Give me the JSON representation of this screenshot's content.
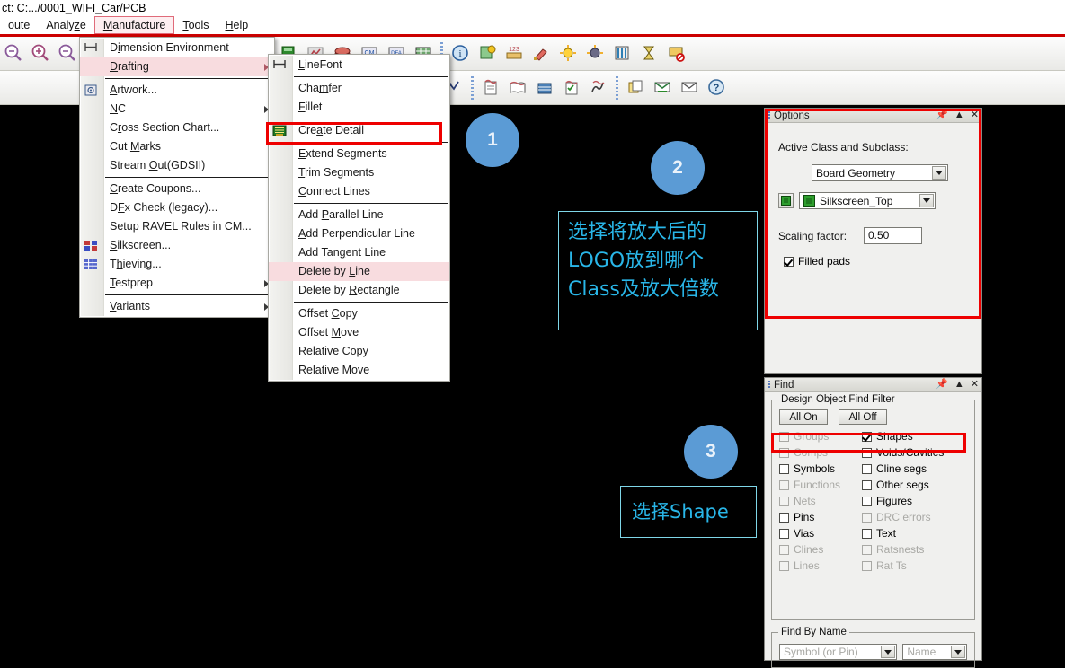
{
  "window": {
    "title": "ct: C:.../0001_WIFI_Car/PCB"
  },
  "menubar": {
    "items": [
      {
        "label": "oute",
        "mnemonic": "",
        "active": false
      },
      {
        "label": "Analyze",
        "mnemonic": "z",
        "active": false
      },
      {
        "label": "Manufacture",
        "mnemonic": "M",
        "active": true
      },
      {
        "label": "Tools",
        "mnemonic": "T",
        "active": false
      },
      {
        "label": "Help",
        "mnemonic": "H",
        "active": false
      }
    ]
  },
  "manufacture_menu": {
    "name": "Manufacture",
    "items": [
      {
        "label": "Dimension Environment",
        "mnemonic": "i",
        "icon": "dimension-icon",
        "submenu": false,
        "highlight": false,
        "separator_after": false
      },
      {
        "label": "Drafting",
        "mnemonic": "D",
        "icon": "",
        "submenu": true,
        "highlight": true,
        "separator_after": true
      },
      {
        "label": "Artwork...",
        "mnemonic": "A",
        "icon": "artwork-icon",
        "submenu": false,
        "highlight": false,
        "separator_after": false
      },
      {
        "label": "NC",
        "mnemonic": "N",
        "icon": "",
        "submenu": true,
        "highlight": false,
        "separator_after": false
      },
      {
        "label": "Cross Section Chart...",
        "mnemonic": "r",
        "icon": "",
        "submenu": false,
        "highlight": false,
        "separator_after": false
      },
      {
        "label": "Cut Marks",
        "mnemonic": "M",
        "icon": "",
        "submenu": false,
        "highlight": false,
        "separator_after": false
      },
      {
        "label": "Stream Out(GDSII)",
        "mnemonic": "O",
        "icon": "",
        "submenu": false,
        "highlight": false,
        "separator_after": true
      },
      {
        "label": "Create Coupons...",
        "mnemonic": "C",
        "icon": "",
        "submenu": false,
        "highlight": false,
        "separator_after": false
      },
      {
        "label": "DFx Check (legacy)...",
        "mnemonic": "F",
        "icon": "",
        "submenu": false,
        "highlight": false,
        "separator_after": false
      },
      {
        "label": "Setup RAVEL Rules in CM...",
        "mnemonic": "",
        "icon": "",
        "submenu": false,
        "highlight": false,
        "separator_after": false
      },
      {
        "label": "Silkscreen...",
        "mnemonic": "S",
        "icon": "silkscreen-icon",
        "submenu": false,
        "highlight": false,
        "separator_after": false
      },
      {
        "label": "Thieving...",
        "mnemonic": "h",
        "icon": "thieving-icon",
        "submenu": false,
        "highlight": false,
        "separator_after": false
      },
      {
        "label": "Testprep",
        "mnemonic": "T",
        "icon": "",
        "submenu": true,
        "highlight": false,
        "separator_after": true
      },
      {
        "label": "Variants",
        "mnemonic": "V",
        "icon": "",
        "submenu": true,
        "highlight": false,
        "separator_after": false
      }
    ]
  },
  "drafting_menu": {
    "name": "Drafting",
    "items": [
      {
        "label": "LineFont",
        "mnemonic": "L",
        "icon": "linefont-icon",
        "submenu": false,
        "highlight": false,
        "separator_after": true
      },
      {
        "label": "Chamfer",
        "mnemonic": "m",
        "icon": "",
        "submenu": false,
        "highlight": false,
        "separator_after": false
      },
      {
        "label": "Fillet",
        "mnemonic": "F",
        "icon": "",
        "submenu": false,
        "highlight": false,
        "separator_after": true
      },
      {
        "label": "Create Detail",
        "mnemonic": "a",
        "icon": "create-detail-icon",
        "submenu": false,
        "highlight": false,
        "separator_after": true,
        "redbox": true
      },
      {
        "label": "Extend Segments",
        "mnemonic": "E",
        "icon": "",
        "submenu": false,
        "highlight": false,
        "separator_after": false
      },
      {
        "label": "Trim Segments",
        "mnemonic": "T",
        "icon": "",
        "submenu": false,
        "highlight": false,
        "separator_after": false
      },
      {
        "label": "Connect Lines",
        "mnemonic": "C",
        "icon": "",
        "submenu": false,
        "highlight": false,
        "separator_after": true
      },
      {
        "label": "Add Parallel Line",
        "mnemonic": "P",
        "icon": "",
        "submenu": false,
        "highlight": false,
        "separator_after": false
      },
      {
        "label": "Add Perpendicular Line",
        "mnemonic": "A",
        "icon": "",
        "submenu": false,
        "highlight": false,
        "separator_after": false
      },
      {
        "label": "Add Tangent Line",
        "mnemonic": "g",
        "icon": "",
        "submenu": false,
        "highlight": false,
        "separator_after": false
      },
      {
        "label": "Delete by Line",
        "mnemonic": "L",
        "icon": "",
        "submenu": false,
        "highlight": true,
        "separator_after": false
      },
      {
        "label": "Delete by Rectangle",
        "mnemonic": "R",
        "icon": "",
        "submenu": false,
        "highlight": false,
        "separator_after": true
      },
      {
        "label": "Offset Copy",
        "mnemonic": "C",
        "icon": "",
        "submenu": false,
        "highlight": false,
        "separator_after": false
      },
      {
        "label": "Offset Move",
        "mnemonic": "M",
        "icon": "",
        "submenu": false,
        "highlight": false,
        "separator_after": false
      },
      {
        "label": "Relative Copy",
        "mnemonic": "",
        "icon": "",
        "submenu": false,
        "highlight": false,
        "separator_after": false
      },
      {
        "label": "Relative Move",
        "mnemonic": "",
        "icon": "",
        "submenu": false,
        "highlight": false,
        "separator_after": false
      }
    ]
  },
  "options_panel": {
    "title": "Options",
    "section_label": "Active Class and Subclass:",
    "class_value": "Board Geometry",
    "subclass_value": "Silkscreen_Top",
    "scaling_label": "Scaling factor:",
    "scaling_value": "0.50",
    "filled_pads_label": "Filled pads",
    "filled_pads_checked": true,
    "titlebar_buttons": [
      "pin-icon",
      "auto-hide-icon",
      "close-icon"
    ]
  },
  "find_panel": {
    "title": "Find",
    "filter_group_title": "Design Object Find Filter",
    "all_on_label": "All On",
    "all_off_label": "All Off",
    "left_column": [
      {
        "label": "Groups",
        "checked": false,
        "disabled": true
      },
      {
        "label": "Comps",
        "checked": false,
        "disabled": true
      },
      {
        "label": "Symbols",
        "checked": false,
        "disabled": false
      },
      {
        "label": "Functions",
        "checked": false,
        "disabled": true
      },
      {
        "label": "Nets",
        "checked": false,
        "disabled": true
      },
      {
        "label": "Pins",
        "checked": false,
        "disabled": false
      },
      {
        "label": "Vias",
        "checked": false,
        "disabled": false
      },
      {
        "label": "Clines",
        "checked": false,
        "disabled": true
      },
      {
        "label": "Lines",
        "checked": false,
        "disabled": true
      }
    ],
    "right_column": [
      {
        "label": "Shapes",
        "checked": true,
        "disabled": false
      },
      {
        "label": "Voids/Cavities",
        "checked": false,
        "disabled": false
      },
      {
        "label": "Cline segs",
        "checked": false,
        "disabled": false
      },
      {
        "label": "Other segs",
        "checked": false,
        "disabled": false
      },
      {
        "label": "Figures",
        "checked": false,
        "disabled": false
      },
      {
        "label": "DRC errors",
        "checked": false,
        "disabled": true
      },
      {
        "label": "Text",
        "checked": false,
        "disabled": false
      },
      {
        "label": "Ratsnests",
        "checked": false,
        "disabled": true
      },
      {
        "label": "Rat Ts",
        "checked": false,
        "disabled": true
      }
    ],
    "find_by_name_title": "Find By Name",
    "find_by_name_type": "Symbol (or Pin)",
    "find_by_name_field": "Name"
  },
  "annotations": {
    "badge1": "1",
    "badge2": "2",
    "badge3": "3",
    "note2_line1": "选择将放大后的",
    "note2_line2": "LOGO放到哪个",
    "note2_line3": "Class及放大倍数",
    "note3_text": "选择Shape"
  },
  "colors": {
    "highlight_red": "#ee0000",
    "badge_blue": "#5b9bd5",
    "annotation_cyan": "#29b6e8",
    "menu_highlight_pink": "#f8dcdf",
    "canvas_black": "#000000",
    "menubar_rule_red": "#cc0000"
  }
}
